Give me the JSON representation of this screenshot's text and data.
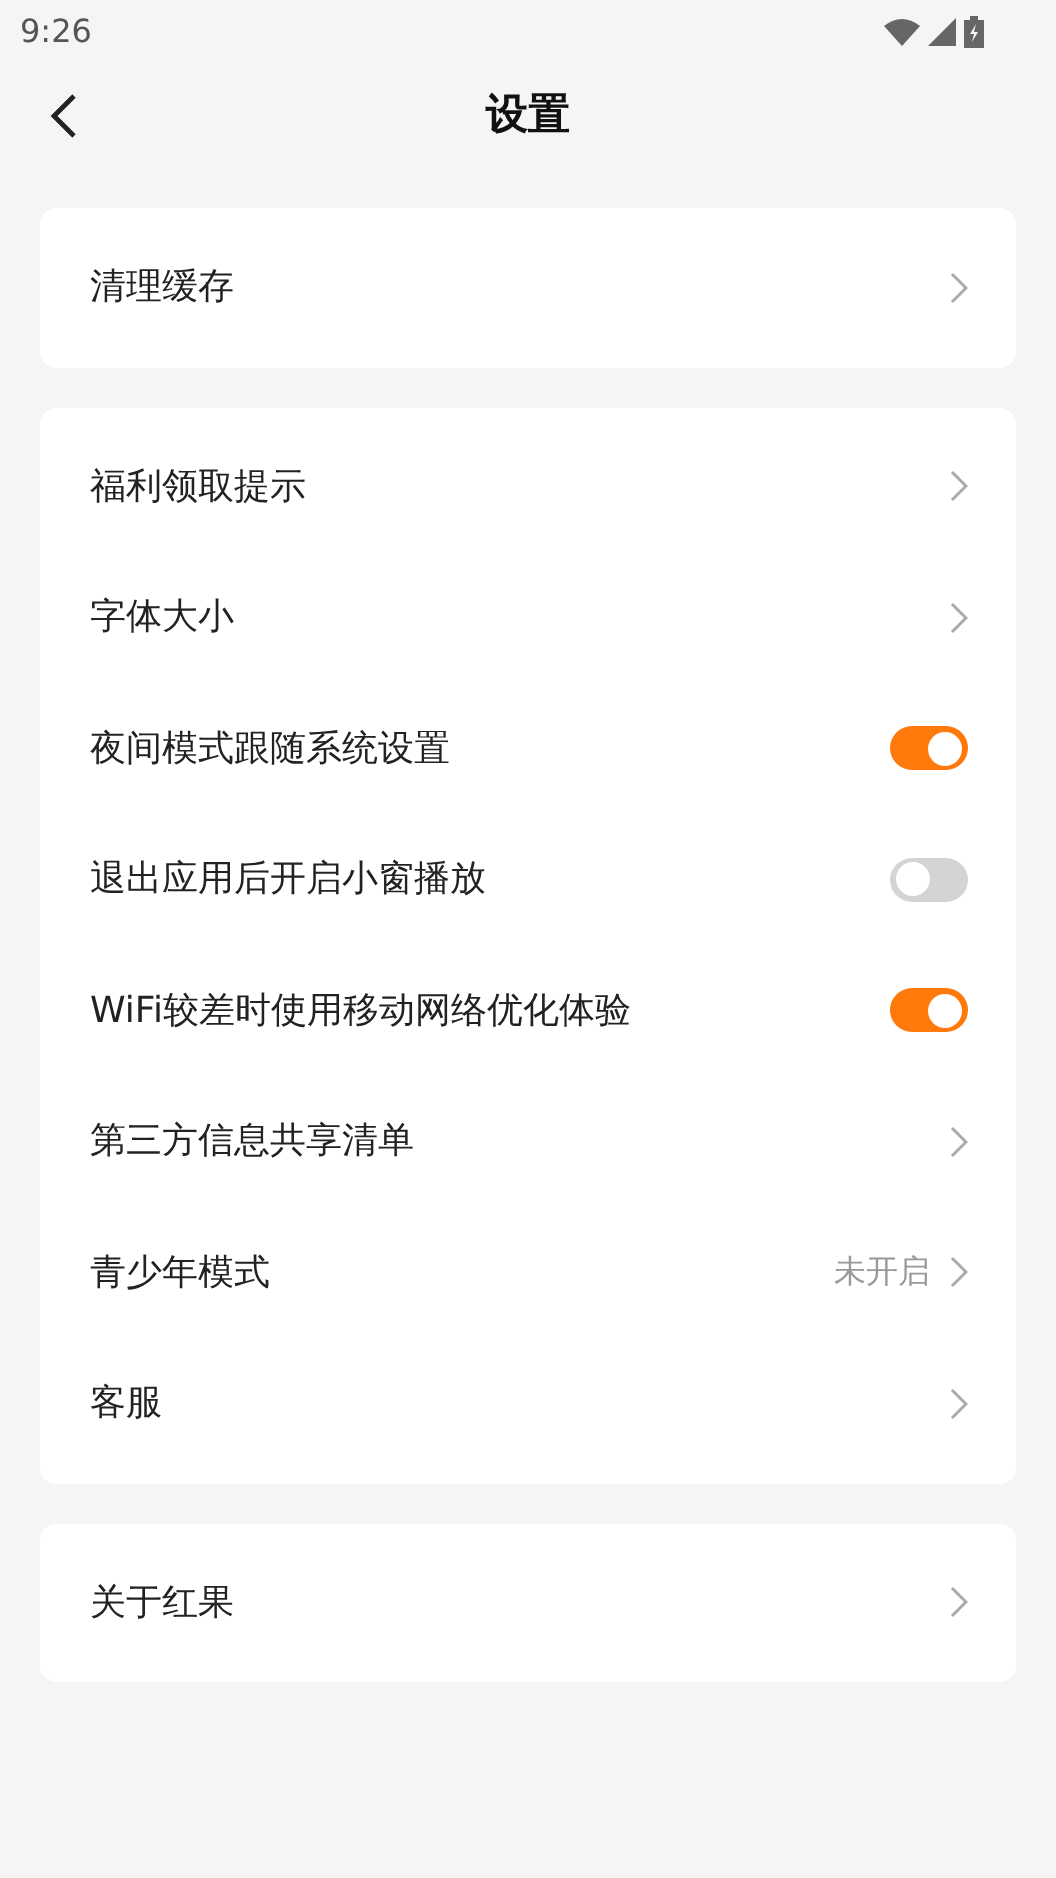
{
  "status_bar": {
    "time": "9:26"
  },
  "header": {
    "title": "设置"
  },
  "groups": [
    {
      "items": [
        {
          "kind": "link",
          "label": "清理缓存"
        }
      ]
    },
    {
      "items": [
        {
          "kind": "link",
          "label": "福利领取提示"
        },
        {
          "kind": "link",
          "label": "字体大小"
        },
        {
          "kind": "toggle",
          "label": "夜间模式跟随系统设置",
          "on": true
        },
        {
          "kind": "toggle",
          "label": "退出应用后开启小窗播放",
          "on": false
        },
        {
          "kind": "toggle",
          "label": "WiFi较差时使用移动网络优化体验",
          "on": true
        },
        {
          "kind": "link",
          "label": "第三方信息共享清单"
        },
        {
          "kind": "link",
          "label": "青少年模式",
          "value": "未开启"
        },
        {
          "kind": "link",
          "label": "客服"
        }
      ]
    },
    {
      "items": [
        {
          "kind": "link",
          "label": "关于红果"
        }
      ]
    }
  ]
}
